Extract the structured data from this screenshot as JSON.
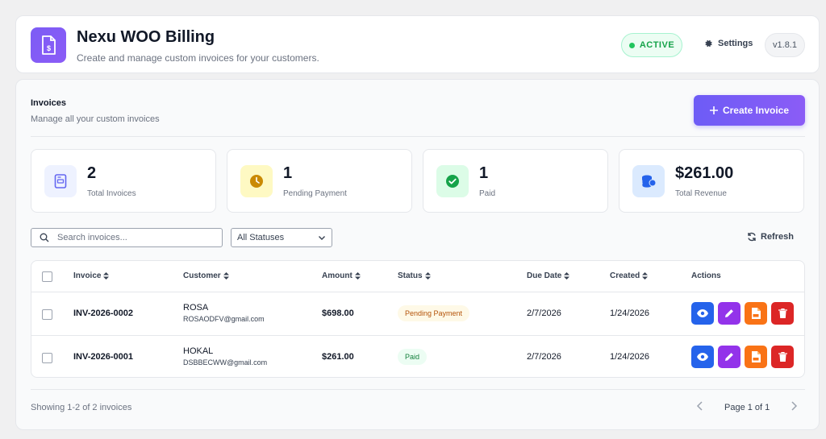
{
  "header": {
    "title": "Nexu WOO Billing",
    "subtitle": "Create and manage custom invoices for your customers.",
    "status": "ACTIVE",
    "settings_label": "Settings",
    "version": "v1.8.1"
  },
  "panel": {
    "title": "Invoices",
    "subtitle": "Manage all your custom invoices",
    "create_button": "Create Invoice"
  },
  "stats": [
    {
      "value": "2",
      "label": "Total Invoices",
      "icon": "invoice-icon",
      "color": "#6366f1"
    },
    {
      "value": "1",
      "label": "Pending Payment",
      "icon": "clock-icon",
      "color": "#ca8a04"
    },
    {
      "value": "1",
      "label": "Paid",
      "icon": "check-circle-icon",
      "color": "#16a34a"
    },
    {
      "value": "$261.00",
      "label": "Total Revenue",
      "icon": "coins-icon",
      "color": "#2563eb"
    }
  ],
  "filters": {
    "search_placeholder": "Search invoices...",
    "status_selected": "All Statuses",
    "refresh_label": "Refresh"
  },
  "table": {
    "columns": [
      "Invoice",
      "Customer",
      "Amount",
      "Status",
      "Due Date",
      "Created",
      "Actions"
    ],
    "rows": [
      {
        "invoice": "INV-2026-0002",
        "customer_name": "ROSA",
        "customer_email": "ROSAODFV@gmail.com",
        "amount": "$698.00",
        "status": "Pending Payment",
        "due_date": "2/7/2026",
        "created": "1/24/2026"
      },
      {
        "invoice": "INV-2026-0001",
        "customer_name": "HOKAL",
        "customer_email": "DSBBECWW@gmail.com",
        "amount": "$261.00",
        "status": "Paid",
        "due_date": "2/7/2026",
        "created": "1/24/2026"
      }
    ]
  },
  "footer": {
    "showing": "Showing 1-2 of 2 invoices",
    "page": "Page 1 of 1"
  },
  "colors": {
    "accent": "#7c5cf5",
    "view": "#2563eb",
    "edit": "#9333ea",
    "pdf": "#f97316",
    "delete": "#dc2626"
  }
}
